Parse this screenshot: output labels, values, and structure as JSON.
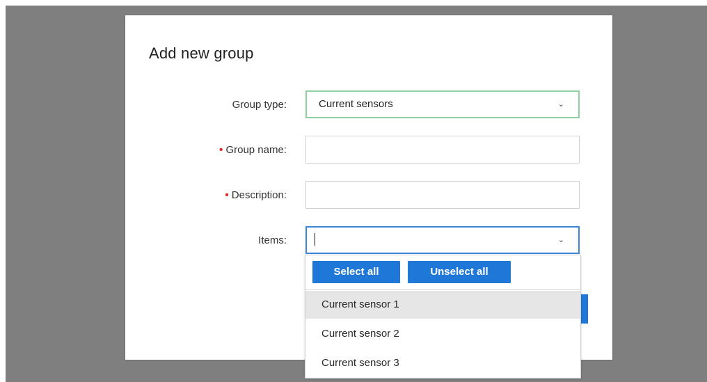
{
  "dialog": {
    "title": "Add new group",
    "fields": {
      "group_type": {
        "label": "Group type:",
        "value": "Current sensors",
        "required": false
      },
      "group_name": {
        "label": "Group name:",
        "value": "",
        "required": true
      },
      "description": {
        "label": "Description:",
        "value": "",
        "required": true
      },
      "items": {
        "label": "Items:",
        "value": "",
        "required": false
      }
    },
    "required_marker": "•",
    "chevron_icon": "chevron-down-icon"
  },
  "items_dropdown": {
    "select_all_label": "Select all",
    "unselect_all_label": "Unselect all",
    "options": [
      "Current sensor 1",
      "Current sensor 2",
      "Current sensor 3"
    ],
    "highlighted_index": 0
  },
  "colors": {
    "overlay": "#7f7f7f",
    "accent_blue": "#1f78d8",
    "focus_green": "#8fcf9f",
    "required_red": "#e0242a"
  }
}
